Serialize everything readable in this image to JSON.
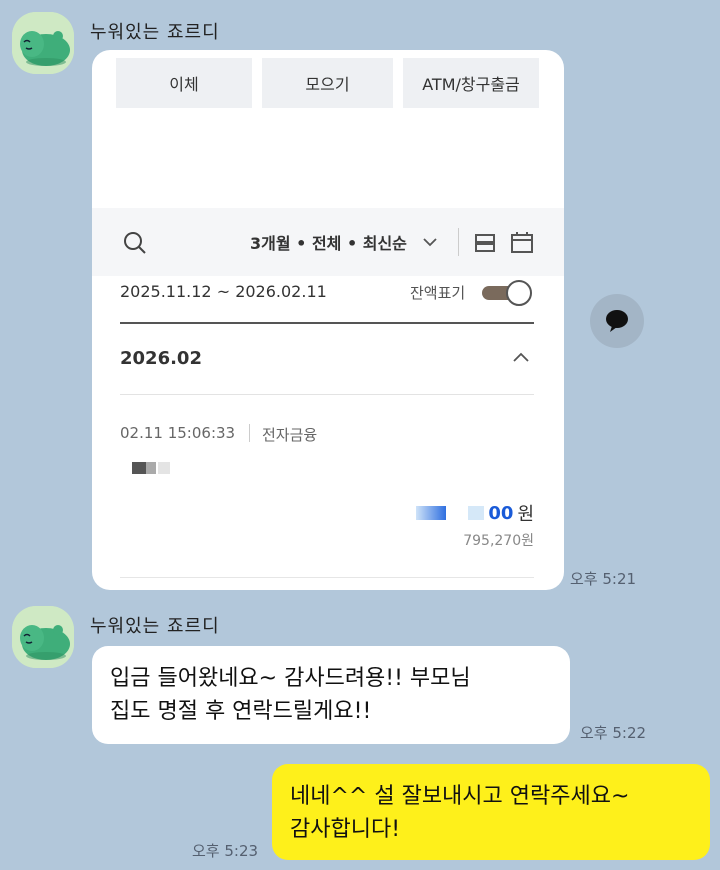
{
  "messages": {
    "sender_name": "누워있는 죠르디",
    "first_time": "오후 5:21",
    "second_time": "오후 5:22",
    "reply_time": "오후 5:23",
    "incoming_line1": "입금 들어왔네요~ 감사드려용!! 부모님",
    "incoming_line2": "집도 명절 후 연락드릴게요!!",
    "reply_line1": "네네^^ 설 잘보내시고 연락주세요~",
    "reply_line2": "감사합니다!"
  },
  "bank_screen": {
    "tabs": [
      "이체",
      "모으기",
      "ATM/창구출금"
    ],
    "filter": "3개월 • 전체 • 최신순",
    "date_range": "2025.11.12 ~ 2026.02.11",
    "balance_toggle_label": "잔액표기",
    "balance_toggle_on": true,
    "month": "2026.02",
    "transaction": {
      "time": "02.11 15:06:33",
      "type": "전자금융",
      "amount_visible_suffix": "00",
      "amount_unit": "원",
      "balance": "795,270원"
    }
  },
  "colors": {
    "chat_background": "#b2c7da",
    "my_bubble": "#fef01b",
    "other_bubble": "#ffffff",
    "amount_blue": "#1a5bd8"
  },
  "icons": [
    "jordy-avatar-icon",
    "search-icon",
    "chevron-down-icon",
    "list-view-icon",
    "calendar-icon",
    "chevron-up-icon",
    "share-speech-icon"
  ]
}
